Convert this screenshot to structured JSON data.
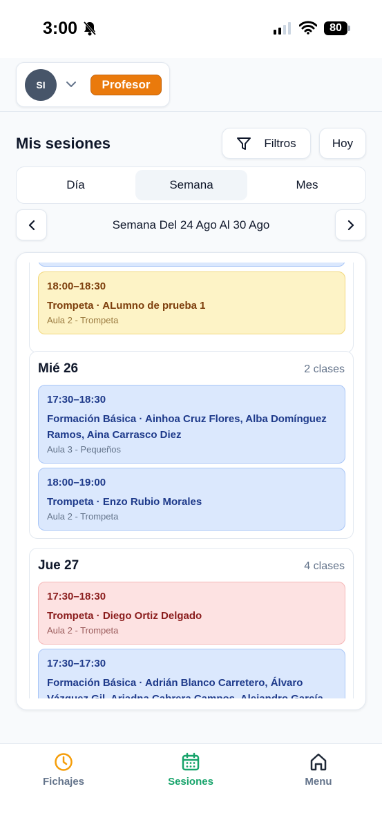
{
  "status_bar": {
    "time": "3:00",
    "battery": "80",
    "icons": [
      "bell-off-icon",
      "signal-icon",
      "wifi-icon",
      "battery-icon"
    ]
  },
  "header": {
    "avatar_initials": "SI",
    "role_badge": "Profesor",
    "role_color": "#ea7a0c"
  },
  "page": {
    "title": "Mis sesiones",
    "filters_label": "Filtros",
    "today_label": "Hoy"
  },
  "view_tabs": [
    {
      "label": "Día",
      "active": false
    },
    {
      "label": "Semana",
      "active": true
    },
    {
      "label": "Mes",
      "active": false
    }
  ],
  "week_nav": {
    "label": "Semana Del 24 Ago Al 30 Ago"
  },
  "days": {
    "tue_partial": {
      "sessions": [
        {
          "time": "18:00–18:30",
          "description": "Trompeta · ALumno de prueba 1",
          "room": "Aula 2 - Trompeta",
          "color": "yellow"
        }
      ]
    },
    "wed": {
      "title": "Mié 26",
      "count": "2 clases",
      "sessions": [
        {
          "time": "17:30–18:30",
          "description": "Formación Básica · Ainhoa Cruz Flores, Alba Domínguez Ramos, Aina Carrasco Diez",
          "room": "Aula 3 - Pequeños",
          "color": "blue"
        },
        {
          "time": "18:00–19:00",
          "description": "Trompeta · Enzo Rubio Morales",
          "room": "Aula 2 - Trompeta",
          "color": "blue"
        }
      ]
    },
    "thu": {
      "title": "Jue 27",
      "count": "4 clases",
      "sessions": [
        {
          "time": "17:30–18:30",
          "description": "Trompeta · Diego Ortiz Delgado",
          "room": "Aula 2 - Trompeta",
          "color": "red"
        },
        {
          "time": "17:30–17:30",
          "description": "Formación Básica · Adrián Blanco Carretero, Álvaro Vázquez Gil, Ariadna Cabrera Campos, Alejandro García",
          "room": "",
          "color": "blue"
        }
      ]
    }
  },
  "bottom_nav": [
    {
      "label": "Fichajes",
      "icon": "clock-icon",
      "active": false,
      "color": "#f59e0b"
    },
    {
      "label": "Sesiones",
      "icon": "calendar-icon",
      "active": true,
      "color": "#16a36a"
    },
    {
      "label": "Menu",
      "icon": "home-icon",
      "active": false,
      "color": "#1f2937"
    }
  ]
}
